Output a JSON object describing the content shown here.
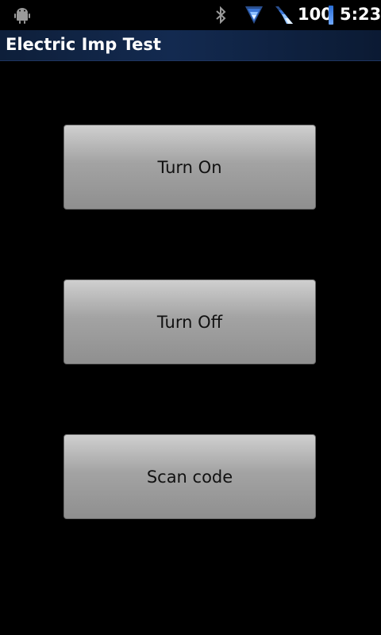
{
  "status_bar": {
    "battery_level": "100",
    "time": "5:23",
    "icons": [
      "android-icon",
      "bluetooth-icon",
      "wifi-icon",
      "signal-icon",
      "battery-icon"
    ]
  },
  "app": {
    "title": "Electric Imp Test"
  },
  "buttons": {
    "turn_on": "Turn On",
    "turn_off": "Turn Off",
    "scan_code": "Scan code"
  },
  "colors": {
    "background": "#000000",
    "title_bar": "#132a50",
    "button_face": "#a3a3a3",
    "battery_accent": "#2b6fd6"
  }
}
